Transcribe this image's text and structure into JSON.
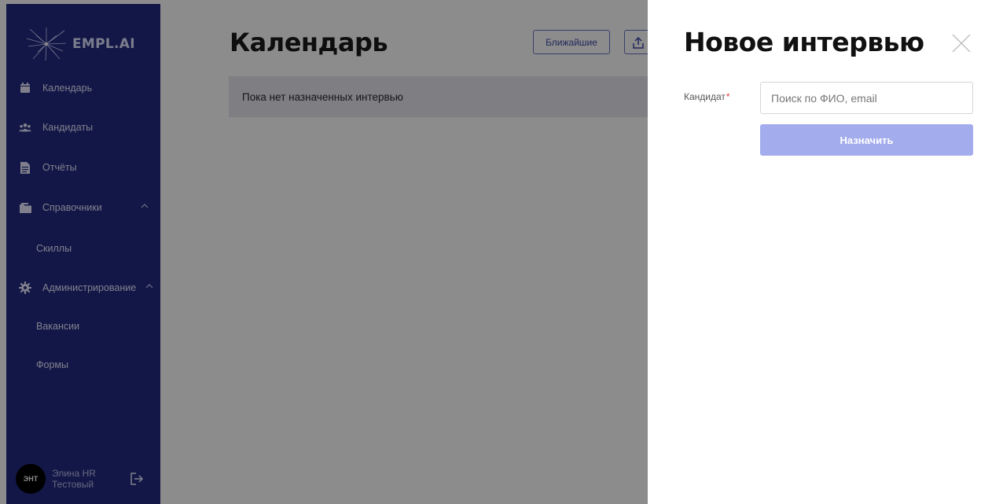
{
  "brand": {
    "name": "EMPL.AI",
    "sidebar_color": "#242b82",
    "accent": "#a3acec"
  },
  "sidebar": {
    "items": [
      {
        "label": "Календарь",
        "icon": "calendar-icon"
      },
      {
        "label": "Кандидаты",
        "icon": "users-icon"
      },
      {
        "label": "Отчёты",
        "icon": "document-icon"
      },
      {
        "label": "Справочники",
        "icon": "folder-icon",
        "expanded": true
      },
      {
        "label": "Администрирование",
        "icon": "gear-icon",
        "expanded": true
      }
    ],
    "subitems": {
      "references": [
        {
          "label": "Скиллы"
        }
      ],
      "administration": [
        {
          "label": "Вакансии"
        },
        {
          "label": "Формы"
        }
      ]
    },
    "user": {
      "initials": "ЭНТ",
      "name": "Элина HR Тестовый",
      "logout_icon": "logout-icon"
    }
  },
  "main": {
    "title": "Календарь",
    "nearest_label": "Ближайшие",
    "export_icon": "upload-icon",
    "empty_message": "Пока нет назначенных интервью"
  },
  "drawer": {
    "title": "Новое интервью",
    "close_icon": "close-icon",
    "candidate_label": "Кандидат",
    "required_mark": "*",
    "search_placeholder": "Поиск по ФИО, email",
    "search_value": "",
    "assign_label": "Назначить"
  }
}
